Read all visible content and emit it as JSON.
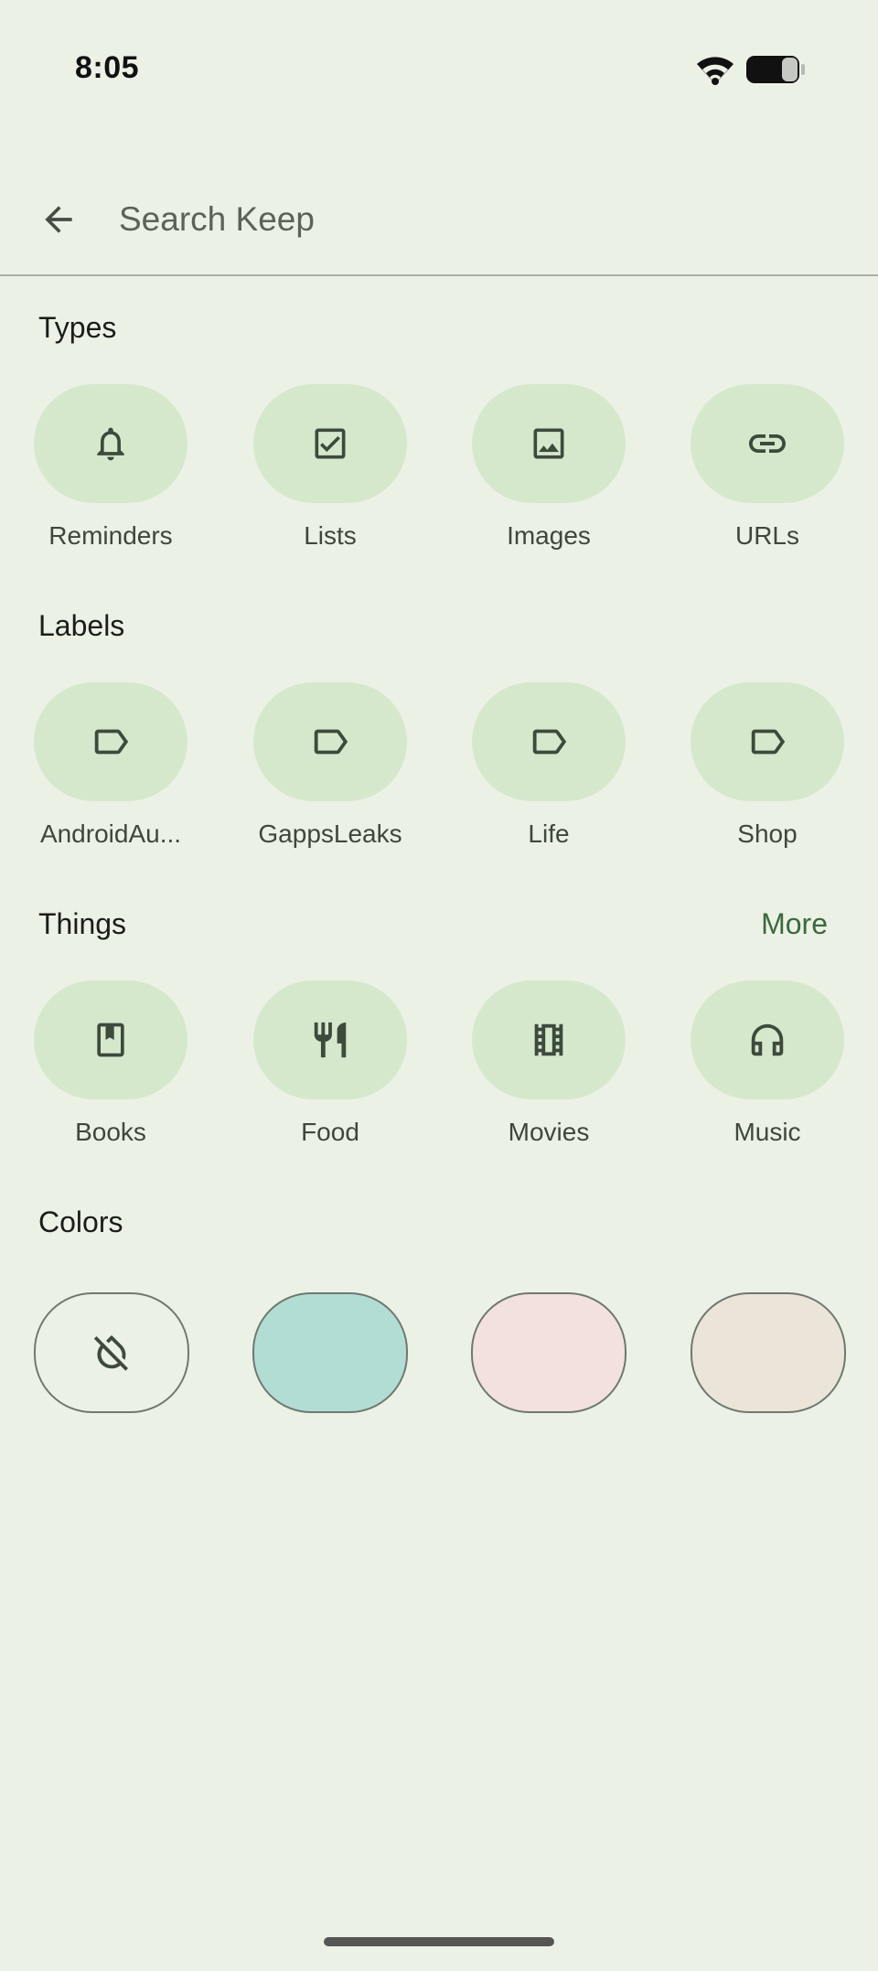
{
  "status_bar": {
    "time": "8:05",
    "wifi_icon": "wifi-icon",
    "battery_icon": "battery-icon"
  },
  "search": {
    "back_icon": "arrow-back-icon",
    "placeholder": "Search Keep",
    "value": ""
  },
  "sections": {
    "types": {
      "title": "Types",
      "items": [
        {
          "label": "Reminders",
          "icon": "bell-icon"
        },
        {
          "label": "Lists",
          "icon": "checkbox-icon"
        },
        {
          "label": "Images",
          "icon": "image-icon"
        },
        {
          "label": "URLs",
          "icon": "link-icon"
        }
      ]
    },
    "labels": {
      "title": "Labels",
      "items": [
        {
          "label": "AndroidAu...",
          "icon": "label-icon"
        },
        {
          "label": "GappsLeaks",
          "icon": "label-icon"
        },
        {
          "label": "Life",
          "icon": "label-icon"
        },
        {
          "label": "Shop",
          "icon": "label-icon"
        }
      ]
    },
    "things": {
      "title": "Things",
      "more_label": "More",
      "items": [
        {
          "label": "Books",
          "icon": "book-icon"
        },
        {
          "label": "Food",
          "icon": "restaurant-icon"
        },
        {
          "label": "Movies",
          "icon": "film-icon"
        },
        {
          "label": "Music",
          "icon": "headphones-icon"
        }
      ]
    },
    "colors": {
      "title": "Colors",
      "items": [
        {
          "name": "no-color",
          "icon": "no-color-icon",
          "fill": "#ecf1e6"
        },
        {
          "name": "teal",
          "fill": "#b2ddd4"
        },
        {
          "name": "pink",
          "fill": "#f3e1dd"
        },
        {
          "name": "beige",
          "fill": "#ebe4d9"
        }
      ]
    }
  },
  "theme": {
    "background": "#ecf1e6",
    "chip": "#d6e8cc",
    "icon": "#3d4a3c",
    "accent": "#3b6a3d"
  }
}
